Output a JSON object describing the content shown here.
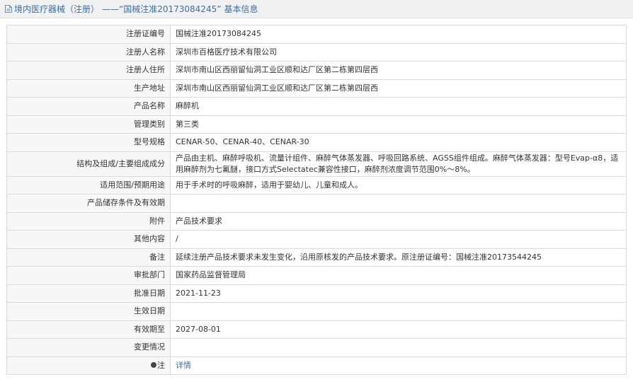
{
  "header": {
    "title_part1": "境内医疗器械（注册）",
    "separator": "——",
    "title_part2": "“国械注准20173084245”",
    "title_part3": "基本信息"
  },
  "rows": [
    {
      "label": "注册证编号",
      "value": "国械注准20173084245"
    },
    {
      "label": "注册人名称",
      "value": "深圳市百格医疗技术有限公司"
    },
    {
      "label": "注册人住所",
      "value": "深圳市南山区西丽留仙洞工业区顺和达厂区第二栋第四层西"
    },
    {
      "label": "生产地址",
      "value": "深圳市南山区西丽留仙洞工业区顺和达厂区第二栋第四层西"
    },
    {
      "label": "产品名称",
      "value": "麻醉机"
    },
    {
      "label": "管理类别",
      "value": "第三类"
    },
    {
      "label": "型号规格",
      "value": "CENAR-50、CENAR-40、CENAR-30"
    },
    {
      "label": "结构及组成/主要组成成分",
      "value": "产品由主机、麻醉呼吸机、流量计组件、麻醉气体蒸发器、呼吸回路系统、AGSS组件组成。麻醉气体蒸发器：型号Evap-α8，适用麻醉剂为七氟醚，接口方式Selectatec兼容性接口，麻醉剂浓度调节范围0%～8%。"
    },
    {
      "label": "适用范围/预期用途",
      "value": "用于手术时的呼吸麻醉，适用于婴幼儿、儿童和成人。"
    },
    {
      "label": "产品储存条件及有效期",
      "value": ""
    },
    {
      "label": "附件",
      "value": "产品技术要求"
    },
    {
      "label": "其他内容",
      "value": "/"
    },
    {
      "label": "备注",
      "value": "延续注册产品技术要求未发生变化，沿用原核发的产品技术要求。原注册证编号：国械注准20173544245"
    },
    {
      "label": "审批部门",
      "value": "国家药品监督管理局"
    },
    {
      "label": "批准日期",
      "value": "2021-11-23"
    },
    {
      "label": "生效日期",
      "value": ""
    },
    {
      "label": "有效期至",
      "value": "2027-08-01"
    },
    {
      "label": "变更情况",
      "value": ""
    },
    {
      "label": "注",
      "value": "详情"
    }
  ],
  "colors": {
    "header_text": "#3b6ea5",
    "header_bg": "#f1f1f1",
    "label_bg": "#f7f7f7",
    "border": "#d9d9d9",
    "link": "#3b6ea5"
  },
  "icons": {
    "header_icon": "document-icon",
    "note_icon": "info-dot-icon"
  }
}
